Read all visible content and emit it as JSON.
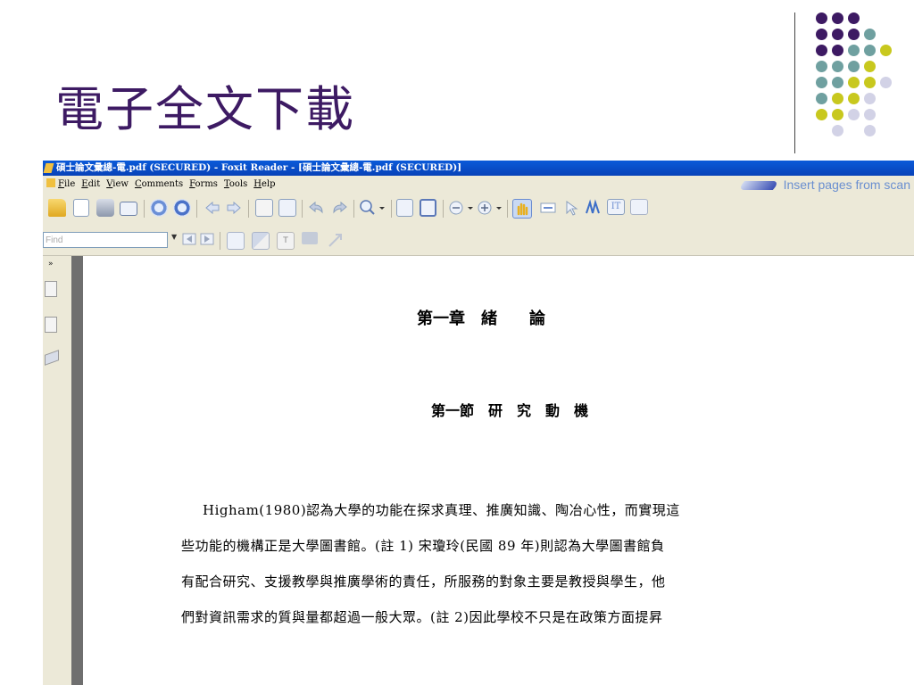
{
  "slide": {
    "title": "電子全文下載"
  },
  "colors": {
    "title": "#3d1a63",
    "dot_purple": "#3d1a63",
    "dot_teal": "#6fa0a0",
    "dot_yellow": "#c8c81e",
    "dot_lavender": "#d2d2e6",
    "titlebar": "#0a5ad9",
    "chrome": "#ece9d8"
  },
  "app": {
    "window_title": "碩士論文彙總-電.pdf (SECURED) - Foxit Reader - [碩士論文彙總-電.pdf (SECURED)]",
    "menu": [
      "File",
      "Edit",
      "View",
      "Comments",
      "Forms",
      "Tools",
      "Help"
    ],
    "promo_text": "Insert pages from scan",
    "find_placeholder": "Find",
    "toolbar_icons": [
      "open-icon",
      "save-icon",
      "print-icon",
      "email-icon",
      "page-up-icon",
      "page-down-icon",
      "back-icon",
      "forward-icon",
      "extract-icon",
      "insert-pages-icon",
      "undo-icon",
      "redo-icon",
      "zoom-icon",
      "fit-page-icon",
      "fit-width-icon",
      "zoom-out-icon",
      "zoom-in-icon",
      "hand-tool-icon",
      "select-text-icon",
      "select-icon",
      "snapshot-icon",
      "typewriter-icon",
      "image-icon"
    ],
    "find_icons": [
      "find-prev-icon",
      "find-next-icon",
      "comment-tool-icon",
      "highlight-icon",
      "note-icon",
      "comment-icon",
      "pencil-icon"
    ],
    "side_icons": [
      "expand-icon",
      "bookmark-icon",
      "pages-icon",
      "layers-icon"
    ]
  },
  "document": {
    "chapter_heading": "第一章　緒　　論",
    "section_heading": "第一節　研　究　動　機",
    "paragraph_lines": [
      "Higham(1980)認為大學的功能在探求真理、推廣知識、陶冶心性，而實現這",
      "些功能的機構正是大學圖書館。(註 1) 宋瓊玲(民國 89 年)則認為大學圖書館負",
      "有配合研究、支援教學與推廣學術的責任，所服務的對象主要是教授與學生，他",
      "們對資訊需求的質與量都超過一般大眾。(註 2)因此學校不只是在政策方面提昇"
    ]
  }
}
